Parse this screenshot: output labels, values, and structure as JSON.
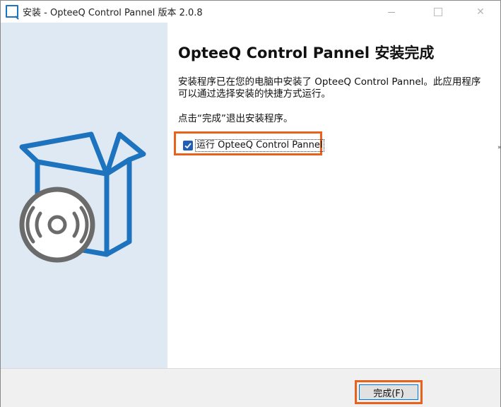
{
  "window": {
    "title": "安装 - OpteeQ Control Pannel 版本 2.0.8",
    "controls": {
      "minimize": "minimize",
      "maximize": "maximize",
      "close": "✕"
    }
  },
  "banner": {
    "illustration": "box-and-disc-icon",
    "colors": {
      "background": "#dfe9f3",
      "box": "#1e73be",
      "disc": "#6b6b6b"
    }
  },
  "content": {
    "heading": "OpteeQ Control Pannel 安装完成",
    "paragraph1": "安装程序已在您的电脑中安装了 OpteeQ Control Pannel。此应用程序可以通过选择安装的快捷方式运行。",
    "paragraph2": "点击“完成”退出安装程序。",
    "run_checkbox": {
      "label": "运行 OpteeQ Control Pannel",
      "checked": true
    },
    "edge_mark": "»"
  },
  "footer": {
    "finish_button": "完成(F)"
  },
  "colors": {
    "highlight": "#e8611d",
    "accent": "#1f5fb8"
  }
}
